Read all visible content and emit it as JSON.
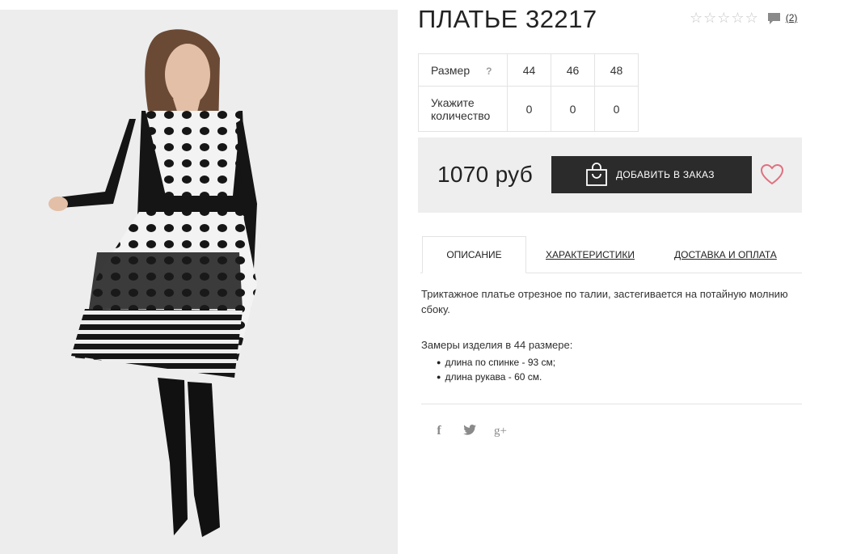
{
  "product": {
    "title": "ПЛАТЬЕ 32217",
    "rating": {
      "value": 0,
      "max": 5,
      "review_count": "(2)"
    },
    "image": {
      "alt": ""
    }
  },
  "sizes": {
    "size_label": "Размер",
    "help": "?",
    "qty_label_line1": "Укажите",
    "qty_label_line2": "количество",
    "columns": [
      "44",
      "46",
      "48"
    ],
    "quantities": [
      "0",
      "0",
      "0"
    ]
  },
  "buy": {
    "price": "1070 руб",
    "add_button": "ДОБАВИТЬ В ЗАКАЗ",
    "add_icon": "shopping-bag-icon",
    "wishlist_icon": "heart-icon",
    "button_color": "#2b2b2b",
    "heart_color": "#e07080"
  },
  "tabs": [
    {
      "label": "ОПИСАНИЕ",
      "active": true
    },
    {
      "label": "ХАРАКТЕРИСТИКИ",
      "active": false
    },
    {
      "label": "ДОСТАВКА И ОПЛАТА",
      "active": false
    }
  ],
  "description": {
    "text": "Триктажное платье отрезное по талии, застегивается на потайную молнию сбоку.",
    "measure_title": "Замеры изделия в 44 размере:",
    "measures": [
      "длина по спинке - 93 см;",
      "длина рукава - 60 см."
    ]
  },
  "social": {
    "facebook": "f",
    "twitter": "twitter-bird-icon",
    "google_plus": "g+"
  }
}
